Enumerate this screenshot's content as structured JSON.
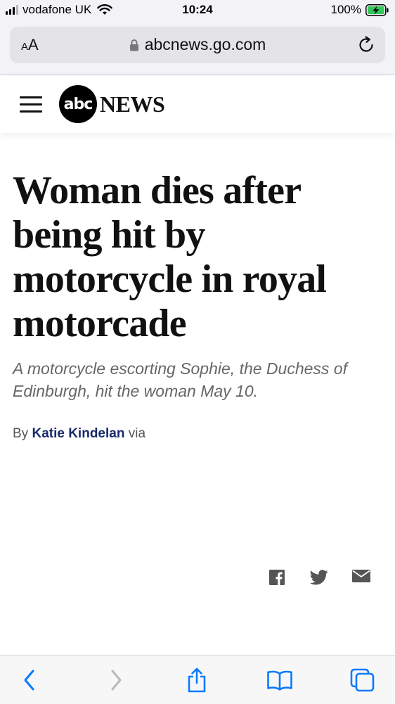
{
  "status_bar": {
    "carrier": "vodafone UK",
    "time": "10:24",
    "battery": "100%"
  },
  "browser": {
    "aa_label_small": "A",
    "aa_label_large": "A",
    "url": "abcnews.go.com"
  },
  "site": {
    "logo_abc": "abc",
    "logo_news": "NEWS"
  },
  "article": {
    "headline": "Woman dies after being hit by motorcycle in royal motorcade",
    "subheadline": "A motorcycle escorting Sophie, the Duchess of Edinburgh, hit the woman May 10.",
    "byline_prefix": "By",
    "author": "Katie Kindelan",
    "byline_suffix": "via"
  },
  "share_icons": [
    "facebook-icon",
    "twitter-icon",
    "email-icon"
  ],
  "toolbar_icons": [
    "back-icon",
    "forward-icon",
    "share-icon",
    "bookmarks-icon",
    "tabs-icon"
  ],
  "colors": {
    "browser_chrome": "#f2f2f7",
    "url_field": "#e3e3e8",
    "battery_green": "#34c759",
    "ios_blue": "#0a7aff",
    "author_link": "#1a2b6b",
    "subhead_gray": "#666666",
    "share_icon_gray": "#555555"
  }
}
